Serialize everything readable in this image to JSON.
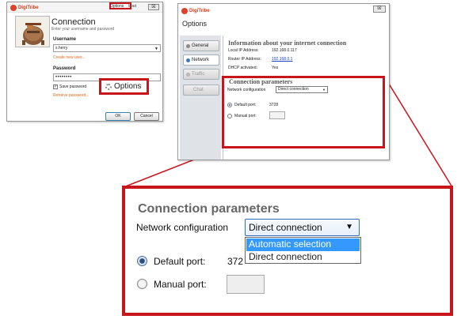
{
  "login": {
    "brand": "DigiTribe",
    "topbar_options": "Options",
    "topbar_about": "bout",
    "close": "☒",
    "heading": "Connection",
    "subheading": "Enter your username and password",
    "username_label": "Username",
    "username_value": "s.herry",
    "create_user_link": "Create new user...",
    "password_label": "Password",
    "password_value": "••••••••",
    "save_password_label": "Save password",
    "save_password_checked": true,
    "retrieve_link": "Retrieve password...",
    "ok_label": "OK",
    "cancel_label": "Cancel",
    "options_highlight": "Options"
  },
  "options_window": {
    "brand": "DigiTribe",
    "title": "Options",
    "close": "☒",
    "tabs": [
      {
        "label": "General",
        "icon": "gear-icon",
        "state": "normal"
      },
      {
        "label": "Network",
        "icon": "network-icon",
        "state": "active"
      },
      {
        "label": "Traffic",
        "icon": "traffic-icon",
        "state": "disabled"
      },
      {
        "label": "Chat",
        "icon": "",
        "state": "disabled"
      }
    ],
    "info_title": "Information about your internet connection",
    "local_ip_label": "Local IP Address:",
    "local_ip_value": "192.168.0.117",
    "router_ip_label": "Router IP Address:",
    "router_ip_value": "192.168.0.1",
    "dhcp_label": "DHCP activated:",
    "dhcp_value": "Yes",
    "conn_title": "Connection parameters",
    "netconf_label": "Network configuration",
    "netconf_value": "Direct connection",
    "default_port_label": "Default port:",
    "default_port_value": "3728",
    "manual_port_label": "Manual port:"
  },
  "zoom": {
    "title": "Connection parameters",
    "netconf_label": "Network configuration",
    "netconf_value": "Direct connection",
    "options": [
      "Automatic selection",
      "Direct connection"
    ],
    "highlighted_option": "Automatic selection",
    "default_port_label": "Default port:",
    "default_port_value": "372",
    "manual_port_label": "Manual port:"
  },
  "colors": {
    "highlight_red": "#c8141b",
    "brand_orange": "#e0691a",
    "selection_blue": "#3399ff"
  }
}
